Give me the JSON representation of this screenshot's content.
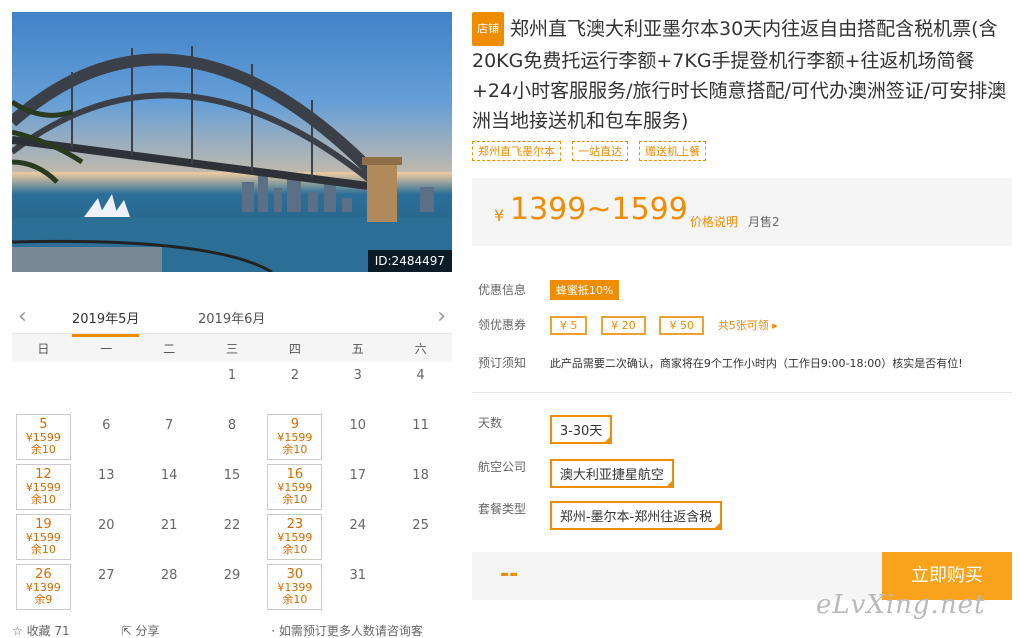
{
  "photo": {
    "id_label": "ID:2484497"
  },
  "calendar": {
    "months": [
      "2019年5月",
      "2019年6月"
    ],
    "weekdays": [
      "日",
      "一",
      "二",
      "三",
      "四",
      "五",
      "六"
    ],
    "days": [
      {
        "d": ""
      },
      {
        "d": ""
      },
      {
        "d": ""
      },
      {
        "d": "1"
      },
      {
        "d": "2"
      },
      {
        "d": "3"
      },
      {
        "d": "4"
      },
      {
        "d": "5",
        "p": "¥1599",
        "s": "余10"
      },
      {
        "d": "6"
      },
      {
        "d": "7"
      },
      {
        "d": "8"
      },
      {
        "d": "9",
        "p": "¥1599",
        "s": "余10"
      },
      {
        "d": "10"
      },
      {
        "d": "11"
      },
      {
        "d": "12",
        "p": "¥1599",
        "s": "余10"
      },
      {
        "d": "13"
      },
      {
        "d": "14"
      },
      {
        "d": "15"
      },
      {
        "d": "16",
        "p": "¥1599",
        "s": "余10"
      },
      {
        "d": "17"
      },
      {
        "d": "18"
      },
      {
        "d": "19",
        "p": "¥1599",
        "s": "余10"
      },
      {
        "d": "20"
      },
      {
        "d": "21"
      },
      {
        "d": "22"
      },
      {
        "d": "23",
        "p": "¥1599",
        "s": "余10"
      },
      {
        "d": "24"
      },
      {
        "d": "25"
      },
      {
        "d": "26",
        "p": "¥1399",
        "s": "余9"
      },
      {
        "d": "27"
      },
      {
        "d": "28"
      },
      {
        "d": "29"
      },
      {
        "d": "30",
        "p": "¥1399",
        "s": "余10"
      },
      {
        "d": "31"
      },
      {
        "d": ""
      }
    ],
    "footer": {
      "favorite": "收藏 71",
      "share": "分享",
      "note": "· 如需预订更多人数请咨询客服"
    }
  },
  "product": {
    "shop_badge": "店铺",
    "title": "郑州直飞澳大利亚墨尔本30天内往返自由搭配含税机票(含20KG免费托运行李额+7KG手提登机行李额+往返机场简餐+24小时客服服务/旅行时长随意搭配/可代办澳洲签证/可安排澳洲当地接送机和包车服务)",
    "tags": [
      "郑州直飞墨尔本",
      "一站直达",
      "赠送机上餐"
    ]
  },
  "price": {
    "currency": "¥",
    "range": "1399~1599",
    "note": "价格说明",
    "sold": "月售2"
  },
  "promo": {
    "label": "优惠信息",
    "badge": "蜂蜜抵10%",
    "coupon_label": "领优惠券",
    "coupons": [
      "¥ 5",
      "¥ 20",
      "¥ 50"
    ],
    "coupon_more": "共5张可领 ▸",
    "notice_label": "预订须知",
    "notice": "此产品需要二次确认，商家将在9个工作小时内（工作日9:00-18:00）核实是否有位!"
  },
  "options": {
    "days_label": "天数",
    "days_value": "3-30天",
    "airline_label": "航空公司",
    "airline_value": "澳大利亚捷星航空",
    "package_label": "套餐类型",
    "package_value": "郑州-墨尔本-郑州往返含税"
  },
  "buy": {
    "total": "--",
    "button": "立即购买"
  },
  "watermark": "eLvXing.net",
  "colors": {
    "accent": "#f08c00",
    "buy_button": "#f9a21c"
  }
}
